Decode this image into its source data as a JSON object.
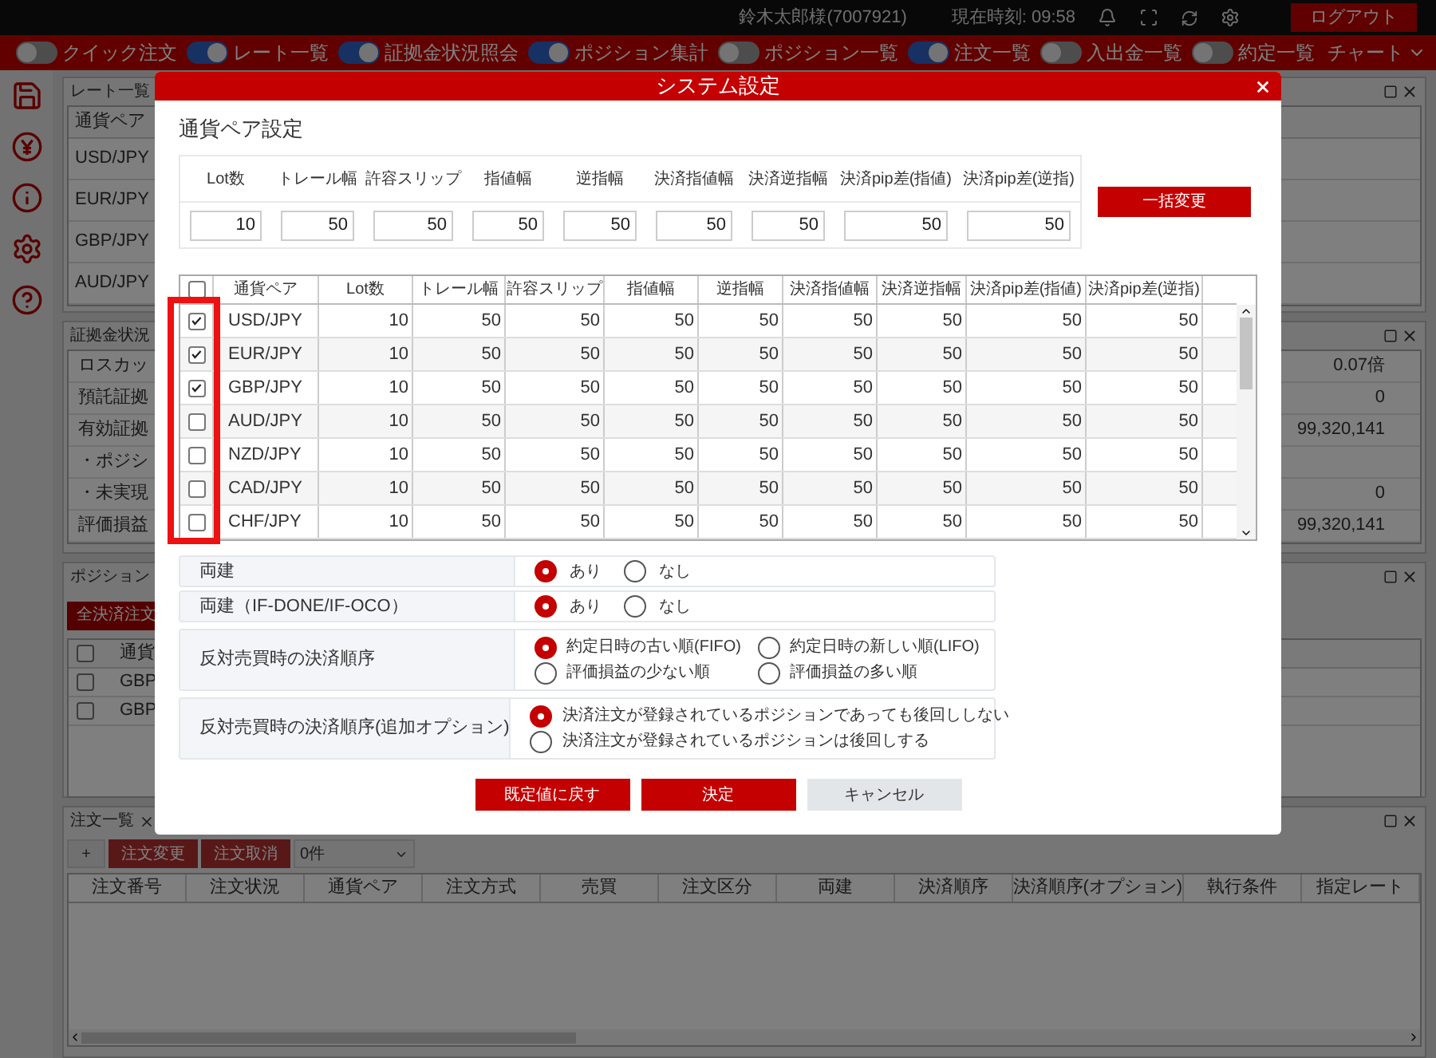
{
  "top_bar": {
    "user": "鈴木太郎様(7007921)",
    "clock": "現在時刻: 09:58",
    "logout_button": "ログアウト"
  },
  "nav": {
    "toggles": [
      {
        "label": "クイック注文",
        "on": false
      },
      {
        "label": "レート一覧",
        "on": true
      },
      {
        "label": "証拠金状況照会",
        "on": true
      },
      {
        "label": "ポジション集計",
        "on": true
      },
      {
        "label": "ポジション一覧",
        "on": false
      },
      {
        "label": "注文一覧",
        "on": true
      },
      {
        "label": "入出金一覧",
        "on": false
      },
      {
        "label": "約定一覧",
        "on": false
      }
    ],
    "chart_menu": "チャート"
  },
  "rate_panel": {
    "title": "レート一覧",
    "column": "通貨ペア",
    "rows": [
      "USD/JPY",
      "EUR/JPY",
      "GBP/JPY",
      "AUD/JPY"
    ]
  },
  "margin_panel": {
    "title": "証拠金状況",
    "rows": [
      {
        "label": "ロスカッ",
        "value": "0.07倍"
      },
      {
        "label": "預託証拠",
        "value": "0"
      },
      {
        "label": "有効証拠",
        "value": "99,320,141"
      },
      {
        "label": "・ポジシ"
      },
      {
        "label": "・未実現",
        "value": "0"
      },
      {
        "label": "評価損益",
        "value": "99,320,141"
      }
    ]
  },
  "position_panel": {
    "title": "ポジション",
    "close_all_button": "全決済注文",
    "all_checked": false,
    "column": "通貨",
    "rows": [
      {
        "checked": false,
        "pair": "GBP"
      },
      {
        "checked": false,
        "pair": "GBP"
      }
    ]
  },
  "order_panel": {
    "title": "注文一覧",
    "add_button": "+",
    "buttons": [
      "注文変更",
      "注文取消"
    ],
    "count": "0件",
    "columns": [
      "注文番号",
      "注文状況",
      "通貨ペア",
      "注文方式",
      "売買",
      "注文区分",
      "両建",
      "決済順序",
      "決済順序(オプション)",
      "執行条件",
      "指定レート"
    ]
  },
  "dialog": {
    "title": "システム設定",
    "section": "通貨ペア設定",
    "bulk": {
      "columns": [
        "Lot数",
        "トレール幅",
        "許容スリップ",
        "指値幅",
        "逆指幅",
        "決済指値幅",
        "決済逆指幅",
        "決済pip差(指値)",
        "決済pip差(逆指)"
      ],
      "values": [
        "10",
        "50",
        "50",
        "50",
        "50",
        "50",
        "50",
        "50",
        "50"
      ],
      "button": "一括変更"
    },
    "grid": {
      "all_checked": false,
      "columns": [
        "通貨ペア",
        "Lot数",
        "トレール幅",
        "許容スリップ",
        "指値幅",
        "逆指幅",
        "決済指値幅",
        "決済逆指幅",
        "決済pip差(指値)",
        "決済pip差(逆指)"
      ],
      "rows": [
        {
          "checked": true,
          "pair": "USD/JPY",
          "values": [
            "10",
            "50",
            "50",
            "50",
            "50",
            "50",
            "50",
            "50",
            "50"
          ]
        },
        {
          "checked": true,
          "pair": "EUR/JPY",
          "values": [
            "10",
            "50",
            "50",
            "50",
            "50",
            "50",
            "50",
            "50",
            "50"
          ]
        },
        {
          "checked": true,
          "pair": "GBP/JPY",
          "values": [
            "10",
            "50",
            "50",
            "50",
            "50",
            "50",
            "50",
            "50",
            "50"
          ]
        },
        {
          "checked": false,
          "pair": "AUD/JPY",
          "values": [
            "10",
            "50",
            "50",
            "50",
            "50",
            "50",
            "50",
            "50",
            "50"
          ]
        },
        {
          "checked": false,
          "pair": "NZD/JPY",
          "values": [
            "10",
            "50",
            "50",
            "50",
            "50",
            "50",
            "50",
            "50",
            "50"
          ]
        },
        {
          "checked": false,
          "pair": "CAD/JPY",
          "values": [
            "10",
            "50",
            "50",
            "50",
            "50",
            "50",
            "50",
            "50",
            "50"
          ]
        },
        {
          "checked": false,
          "pair": "CHF/JPY",
          "values": [
            "10",
            "50",
            "50",
            "50",
            "50",
            "50",
            "50",
            "50",
            "50"
          ]
        }
      ]
    },
    "options": [
      {
        "label": "両建",
        "kind": "inline",
        "choices": [
          {
            "label": "あり",
            "selected": true
          },
          {
            "label": "なし",
            "selected": false
          }
        ]
      },
      {
        "label": "両建（IF-DONE/IF-OCO）",
        "kind": "inline",
        "choices": [
          {
            "label": "あり",
            "selected": true
          },
          {
            "label": "なし",
            "selected": false
          }
        ]
      },
      {
        "label": "反対売買時の決済順序",
        "kind": "grid",
        "choices": [
          {
            "label": "約定日時の古い順(FIFO)",
            "selected": true
          },
          {
            "label": "約定日時の新しい順(LIFO)",
            "selected": false
          },
          {
            "label": "評価損益の少ない順",
            "selected": false
          },
          {
            "label": "評価損益の多い順",
            "selected": false
          }
        ]
      },
      {
        "label": "反対売買時の決済順序(追加オプション)",
        "kind": "stack",
        "choices": [
          {
            "label": "決済注文が登録されているポジションであっても後回ししない",
            "selected": true
          },
          {
            "label": "決済注文が登録されているポジションは後回しする",
            "selected": false
          }
        ]
      }
    ],
    "buttons": [
      {
        "label": "既定値に戻す",
        "kind": "primary"
      },
      {
        "label": "決定",
        "kind": "primary"
      },
      {
        "label": "キャンセル",
        "kind": "secondary"
      }
    ]
  }
}
